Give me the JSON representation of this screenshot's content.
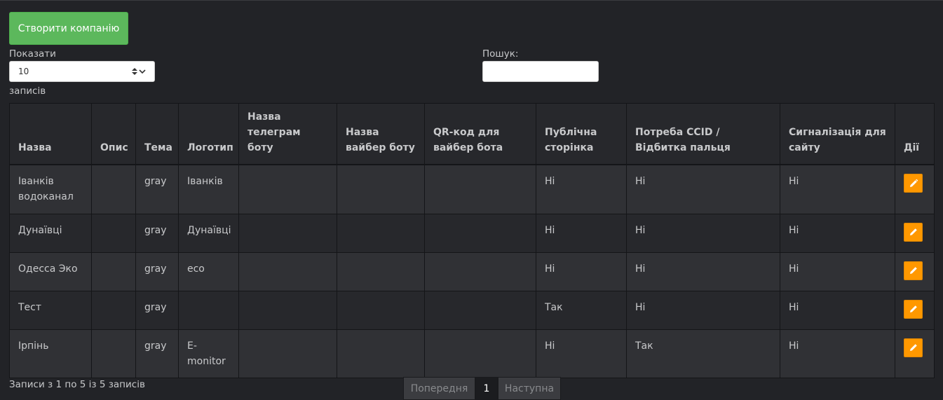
{
  "toolbar": {
    "create_label": "Створити компанію"
  },
  "length": {
    "show_label": "Показати",
    "value": "10",
    "entries_label": "записів"
  },
  "search": {
    "label": "Пошук:",
    "value": ""
  },
  "table": {
    "headers": [
      "Назва",
      "Опис",
      "Тема",
      "Логотип",
      "Назва телеграм боту",
      "Назва вайбер боту",
      "QR-код для вайбер бота",
      "Публічна сторінка",
      "Потреба CCID / Відбитка пальця",
      "Сигналізація для сайту",
      "Дії"
    ],
    "rows": [
      [
        "Іванків водоканал",
        "",
        "gray",
        "Іванків",
        "",
        "",
        "",
        "Ні",
        "Ні",
        "Ні"
      ],
      [
        "Дунаївці",
        "",
        "gray",
        "Дунаївці",
        "",
        "",
        "",
        "Ні",
        "Ні",
        "Ні"
      ],
      [
        "Одесса Эко",
        "",
        "gray",
        "eco",
        "",
        "",
        "",
        "Ні",
        "Ні",
        "Ні"
      ],
      [
        "Тест",
        "",
        "gray",
        "",
        "",
        "",
        "",
        "Так",
        "Ні",
        "Ні"
      ],
      [
        "Ірпінь",
        "",
        "gray",
        "E-monitor",
        "",
        "",
        "",
        "Ні",
        "Так",
        "Ні"
      ]
    ],
    "action_icon": "pencil-icon"
  },
  "footer": {
    "info": "Записи з 1 по 5 із 5 записів",
    "prev": "Попередня",
    "page": "1",
    "next": "Наступна"
  },
  "colors": {
    "create": "#5cb85c",
    "edit": "#ff9800",
    "background": "#222327"
  }
}
